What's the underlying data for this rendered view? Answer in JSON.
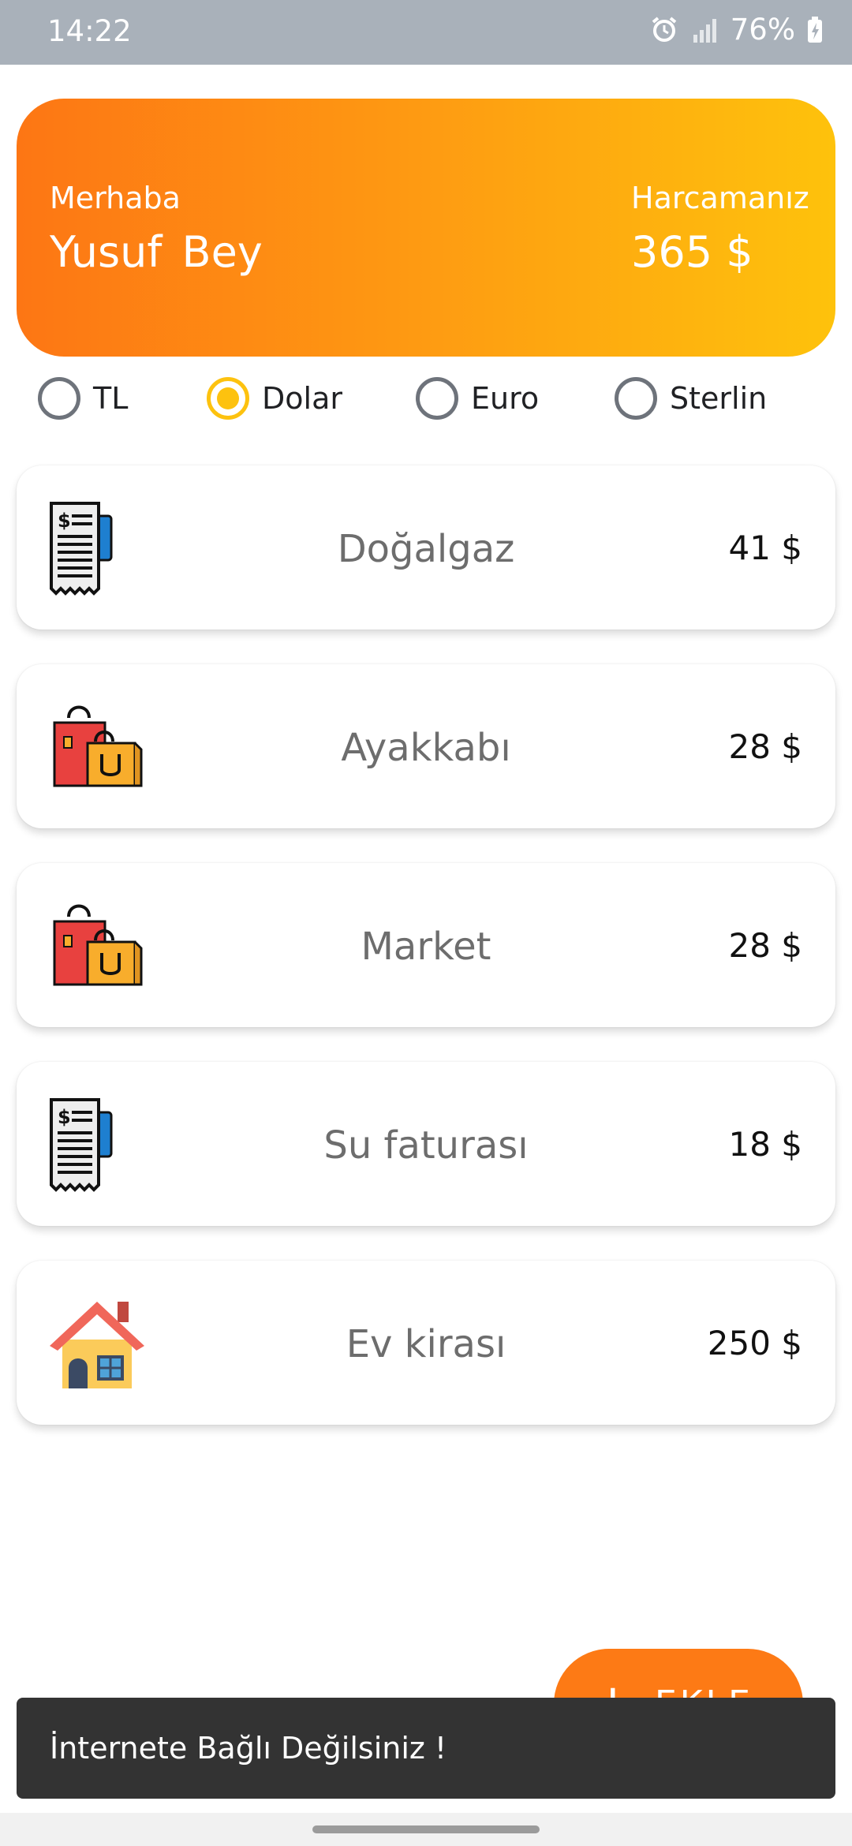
{
  "status_bar": {
    "time": "14:22",
    "battery": "76%",
    "icons": [
      "alarm-icon",
      "signal-icon",
      "battery-charging-icon"
    ]
  },
  "header": {
    "greeting": "Merhaba",
    "name": "Yusuf Bey",
    "spent_label": "Harcamanız",
    "spent_value": "365 $",
    "gradient": [
      "#fd7614",
      "#fec20c"
    ]
  },
  "currency_options": [
    {
      "label": "TL",
      "selected": false
    },
    {
      "label": "Dolar",
      "selected": true
    },
    {
      "label": "Euro",
      "selected": false
    },
    {
      "label": "Sterlin",
      "selected": false
    }
  ],
  "expenses": [
    {
      "title": "Doğalgaz",
      "amount": "41 $",
      "icon": "receipt-icon"
    },
    {
      "title": "Ayakkabı",
      "amount": "28 $",
      "icon": "shopping-bags-icon"
    },
    {
      "title": "Market",
      "amount": "28 $",
      "icon": "shopping-bags-icon"
    },
    {
      "title": "Su faturası",
      "amount": "18 $",
      "icon": "receipt-icon"
    },
    {
      "title": "Ev kirası",
      "amount": "250 $",
      "icon": "house-icon"
    }
  ],
  "fab": {
    "label": "EKLE",
    "icon": "plus-icon"
  },
  "snackbar": {
    "message": "İnternete Bağlı Değilsiniz !"
  },
  "colors": {
    "accent": "#fd7a15",
    "radio_selected": "#fdc20f",
    "status_bar": "#a9b1ba"
  }
}
